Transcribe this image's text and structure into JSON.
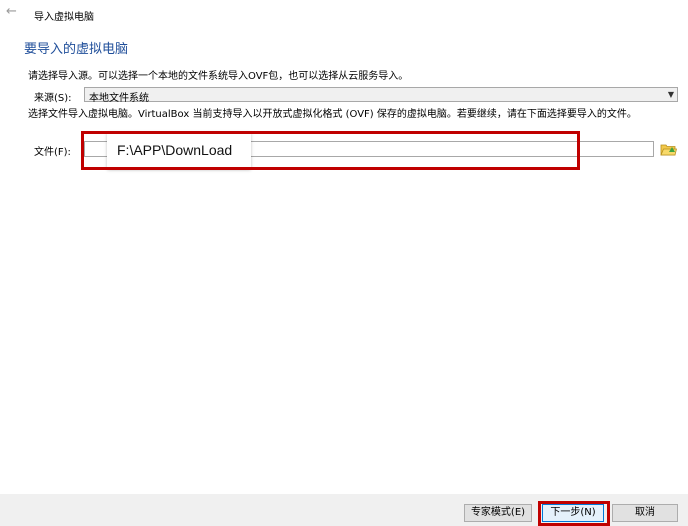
{
  "window": {
    "title": "导入虚拟电脑",
    "back_icon": "←"
  },
  "heading": "要导入的虚拟电脑",
  "description_source": "请选择导入源。可以选择一个本地的文件系统导入OVF包，也可以选择从云服务导入。",
  "source": {
    "label": "来源(S):",
    "value": "本地文件系统"
  },
  "description_file": "选择文件导入虚拟电脑。VirtualBox 当前支持导入以开放式虚拟化格式 (OVF) 保存的虚拟电脑。若要继续，请在下面选择要导入的文件。",
  "file": {
    "label": "文件(F):",
    "value": "F:\\APP\\DownLoad"
  },
  "buttons": {
    "expert": "专家模式(E)",
    "next": "下一步(N)",
    "cancel": "取消"
  },
  "colors": {
    "heading": "#1f4e9a",
    "highlight": "#c00000",
    "default_button_border": "#0078d7"
  }
}
